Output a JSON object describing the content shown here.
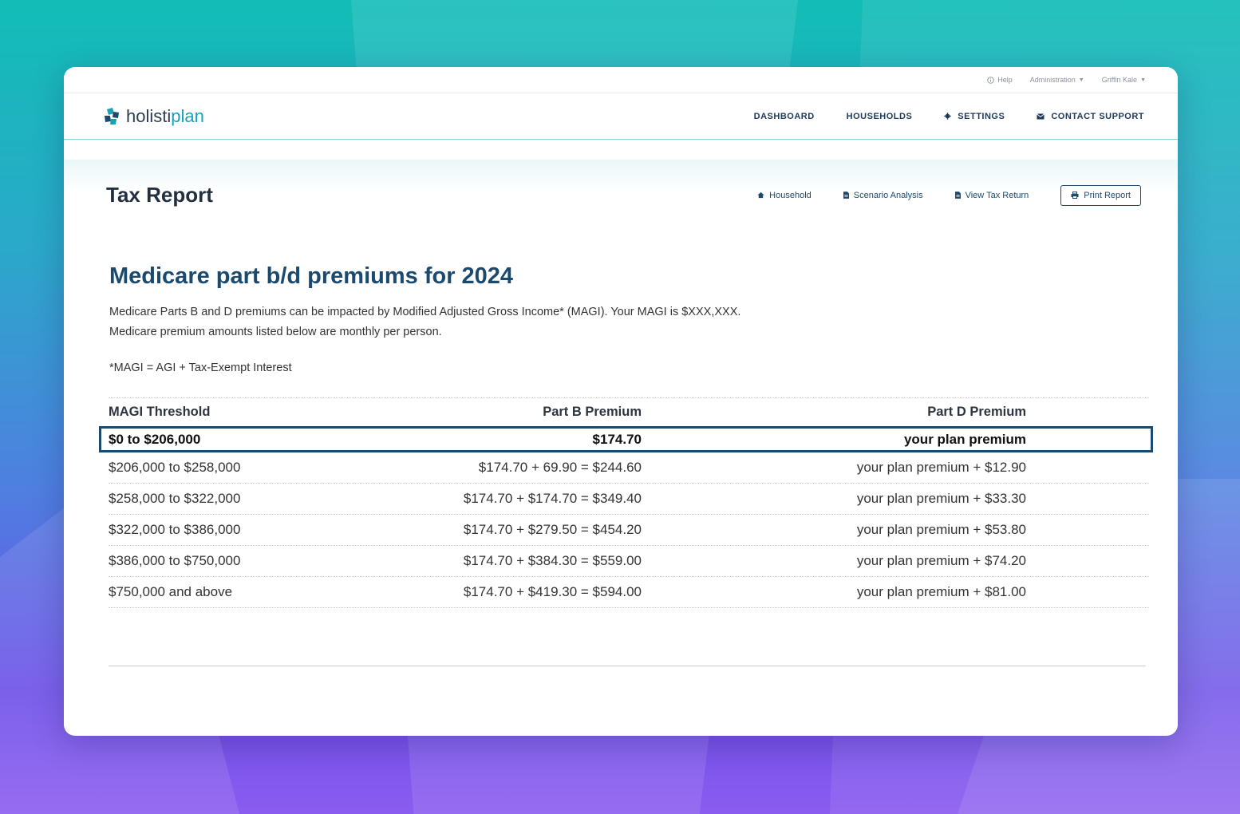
{
  "utility_bar": {
    "help": "Help",
    "administration": "Administration",
    "user": "Griffin Kale"
  },
  "brand": {
    "logo_text_a": "holisti",
    "logo_text_b": "plan"
  },
  "nav": {
    "dashboard": "DASHBOARD",
    "households": "HOUSEHOLDS",
    "settings": "SETTINGS",
    "contact_support": "CONTACT SUPPORT"
  },
  "page": {
    "title": "Tax Report",
    "actions": {
      "household": "Household",
      "scenario_analysis": "Scenario Analysis",
      "view_tax_return": "View Tax Return",
      "print_report": "Print Report"
    }
  },
  "section": {
    "title": "Medicare part b/d premiums for 2024",
    "desc_line1": "Medicare Parts B and D premiums can be impacted by Modified Adjusted Gross Income* (MAGI). Your MAGI is  $XXX,XXX.",
    "desc_line2": "Medicare premium amounts listed below are monthly per person.",
    "footnote": "*MAGI = AGI + Tax-Exempt Interest"
  },
  "table": {
    "headers": [
      "MAGI Threshold",
      "Part B Premium",
      "Part D Premium"
    ],
    "highlight_row": [
      "$0 to $206,000",
      "$174.70",
      "your plan premium"
    ],
    "rows": [
      [
        "$206,000 to $258,000",
        "$174.70 + 69.90 = $244.60",
        "your plan premium + $12.90"
      ],
      [
        "$258,000 to $322,000",
        "$174.70 + $174.70 = $349.40",
        "your plan premium + $33.30"
      ],
      [
        "$322,000 to $386,000",
        "$174.70 + $279.50 = $454.20",
        "your plan premium + $53.80"
      ],
      [
        "$386,000 to $750,000",
        "$174.70 + $384.30 = $559.00",
        "your plan premium + $74.20"
      ],
      [
        "$750,000 and above",
        "$174.70 + $419.30 = $594.00",
        "your plan premium + $81.00"
      ]
    ]
  },
  "colors": {
    "primary": "#1b4a6e",
    "accent": "#17a2b8"
  },
  "icons": {
    "help": "info-circle-icon",
    "settings": "gear-icon",
    "contact": "envelope-icon",
    "household": "home-icon",
    "scenario": "document-icon",
    "tax_return": "document-icon",
    "print": "printer-icon"
  }
}
